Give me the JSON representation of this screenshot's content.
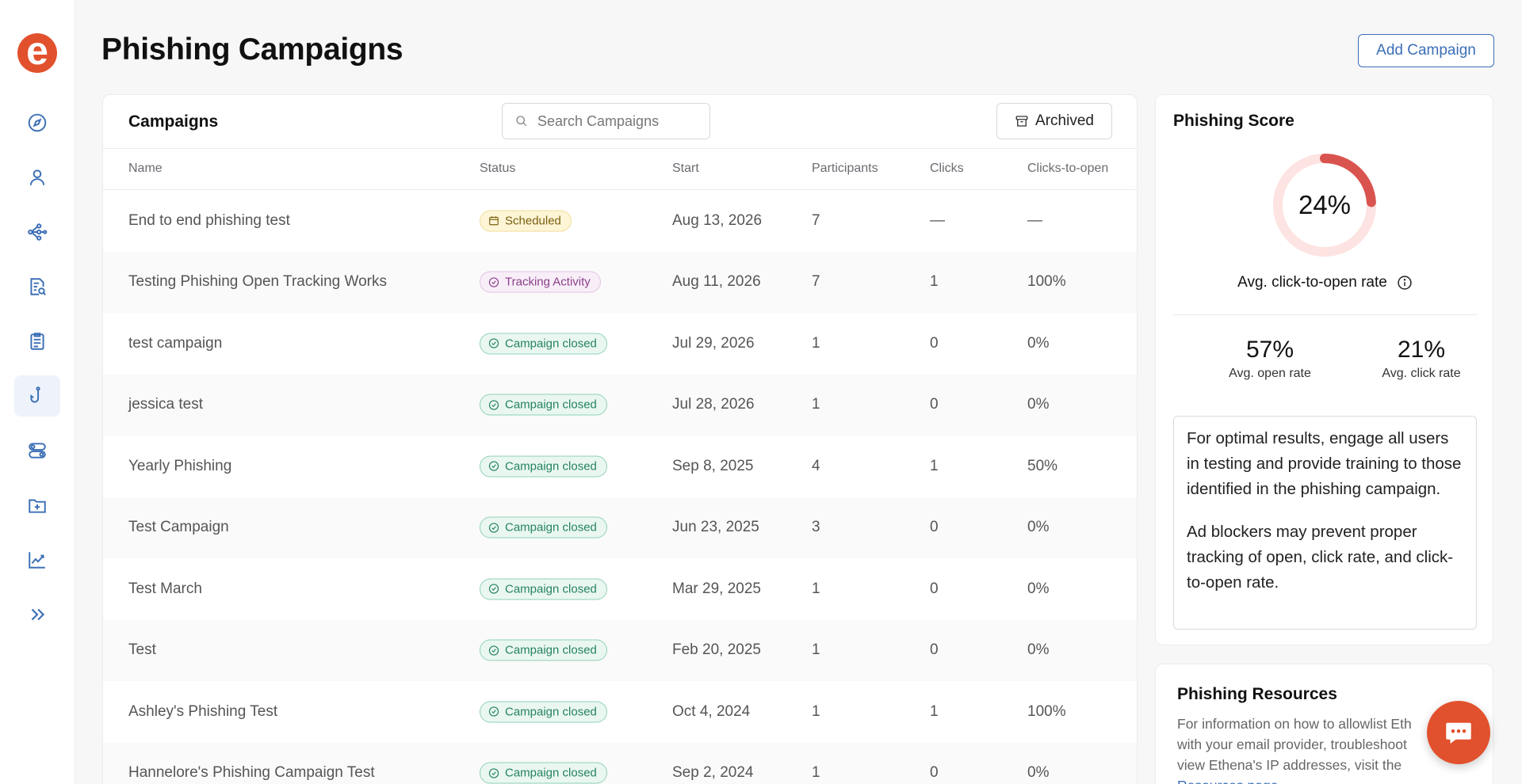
{
  "brand": {
    "logo_letter": "e",
    "accent": "#e2512d",
    "link_color": "#3b6fb6"
  },
  "sidebar": {
    "items": [
      {
        "name": "dashboard",
        "icon": "compass-icon"
      },
      {
        "name": "users",
        "icon": "user-icon"
      },
      {
        "name": "workflows",
        "icon": "network-icon"
      },
      {
        "name": "reports",
        "icon": "document-search-icon"
      },
      {
        "name": "courses",
        "icon": "clipboard-list-icon"
      },
      {
        "name": "phishing",
        "icon": "fishing-hook-icon",
        "active": true
      },
      {
        "name": "groups",
        "icon": "toggles-icon"
      },
      {
        "name": "folders",
        "icon": "folder-plus-icon"
      },
      {
        "name": "analytics",
        "icon": "chart-line-icon"
      },
      {
        "name": "expand",
        "icon": "double-chevron-right-icon"
      }
    ]
  },
  "header": {
    "title": "Phishing Campaigns",
    "add_label": "Add Campaign"
  },
  "campaigns": {
    "title": "Campaigns",
    "search_placeholder": "Search Campaigns",
    "archived_label": "Archived",
    "columns": [
      "Name",
      "Status",
      "Start",
      "Participants",
      "Clicks",
      "Clicks-to-open"
    ],
    "rows": [
      {
        "name": "End to end phishing test",
        "status": "Scheduled",
        "status_type": "scheduled",
        "start": "Aug 13, 2026",
        "participants": "7",
        "clicks": "—",
        "cto": "—"
      },
      {
        "name": "Testing Phishing Open Tracking Works",
        "status": "Tracking Activity",
        "status_type": "tracking",
        "start": "Aug 11, 2026",
        "participants": "7",
        "clicks": "1",
        "cto": "100%"
      },
      {
        "name": "test campaign",
        "status": "Campaign closed",
        "status_type": "closed",
        "start": "Jul 29, 2026",
        "participants": "1",
        "clicks": "0",
        "cto": "0%"
      },
      {
        "name": "jessica test",
        "status": "Campaign closed",
        "status_type": "closed",
        "start": "Jul 28, 2026",
        "participants": "1",
        "clicks": "0",
        "cto": "0%"
      },
      {
        "name": "Yearly Phishing",
        "status": "Campaign closed",
        "status_type": "closed",
        "start": "Sep 8, 2025",
        "participants": "4",
        "clicks": "1",
        "cto": "50%"
      },
      {
        "name": "Test Campaign",
        "status": "Campaign closed",
        "status_type": "closed",
        "start": "Jun 23, 2025",
        "participants": "3",
        "clicks": "0",
        "cto": "0%"
      },
      {
        "name": "Test March",
        "status": "Campaign closed",
        "status_type": "closed",
        "start": "Mar 29, 2025",
        "participants": "1",
        "clicks": "0",
        "cto": "0%"
      },
      {
        "name": "Test",
        "status": "Campaign closed",
        "status_type": "closed",
        "start": "Feb 20, 2025",
        "participants": "1",
        "clicks": "0",
        "cto": "0%"
      },
      {
        "name": "Ashley's Phishing Test",
        "status": "Campaign closed",
        "status_type": "closed",
        "start": "Oct 4, 2024",
        "participants": "1",
        "clicks": "1",
        "cto": "100%"
      },
      {
        "name": "Hannelore's Phishing Campaign Test",
        "status": "Campaign closed",
        "status_type": "closed",
        "start": "Sep 2, 2024",
        "participants": "1",
        "clicks": "0",
        "cto": "0%"
      }
    ]
  },
  "score": {
    "title": "Phishing Score",
    "value": "24%",
    "fraction": 0.24,
    "label": "Avg. click-to-open rate",
    "open_rate": "57%",
    "open_label": "Avg. open rate",
    "click_rate": "21%",
    "click_label": "Avg. click rate",
    "tip1": "For optimal results, engage all users in testing and provide training to those identified in the phishing campaign.",
    "tip2": "Ad blockers may prevent proper tracking of open, click rate, and click-to-open rate.",
    "ring_color": "#d9534f",
    "track_color": "#fde3e1"
  },
  "resources": {
    "title": "Phishing Resources",
    "line1": "For information on how to allowlist Eth",
    "line2": "with your email provider, troubleshoot",
    "line3": "view Ethena's IP addresses, visit the",
    "link_text": "Resources page."
  }
}
